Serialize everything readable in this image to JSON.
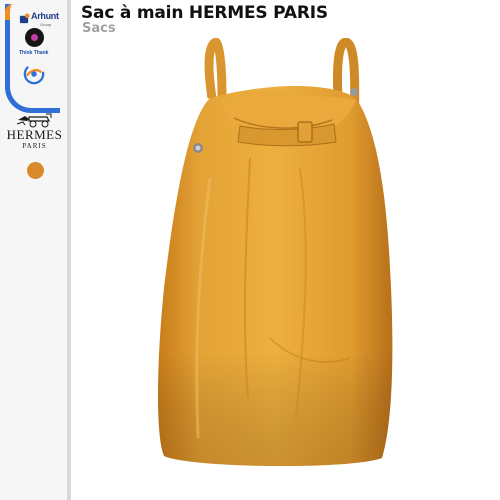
{
  "header": {
    "title": "Sac à main HERMES PARIS",
    "category": "Sacs"
  },
  "sidebar": {
    "brand_name": "Arhunt",
    "brand_tagline": "Group",
    "think_label": "Think Thank",
    "designer_brand": "HERMES",
    "designer_city": "PARIS",
    "selected_color": "#d98a2b",
    "accent_blue": "#2f6fd6",
    "accent_orange": "#f08c22"
  },
  "product": {
    "image_subject": "yellow-orange leather handbag"
  }
}
